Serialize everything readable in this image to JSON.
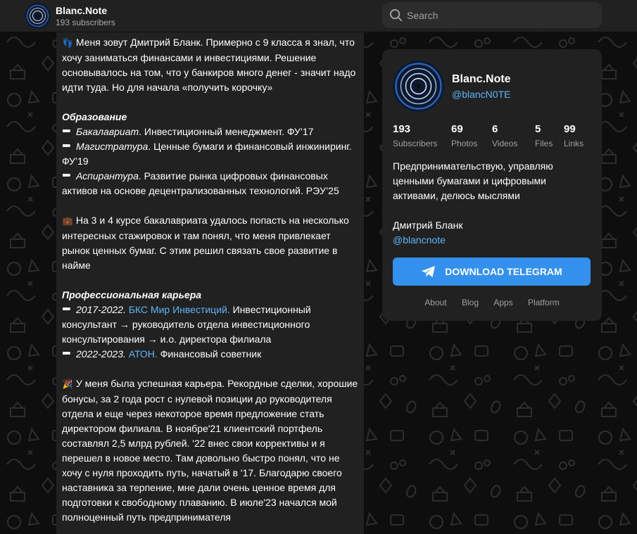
{
  "header": {
    "channel_title": "Blanc.Note",
    "subscribers_label": "193 subscribers"
  },
  "search": {
    "placeholder": "Search",
    "value": ""
  },
  "post": {
    "intro": "Меня зовут Дмитрий Бланк. Примерно с 9 класса я знал, что хочу заниматься финансами и инвестициями. Решение основывалось на том, что у банкиров много денег - значит надо идти туда. Но для начала «получить корочку»",
    "education_heading": "Образование",
    "edu1_label": "Бакалавриат",
    "edu1_text": ". Инвестиционный менеджмент. ФУ’17",
    "edu2_label": "Магистратура",
    "edu2_text": ". Ценные бумаги и финансовый инжиниринг. ФУ’19",
    "edu3_label": "Аспирантура",
    "edu3_text": ". Развитие рынка цифровых финансовых активов на основе децентрализованных технологий. РЭУ’25",
    "internship": "На 3 и 4 курсе бакалавриата удалось попасть на несколько интересных стажировок и там понял, что меня привлекает рынок ценных бумаг. С этим решил связать свое развитие в найме",
    "career_heading": "Профессиональная карьера",
    "job1_period": "2017-2022.",
    "job1_link": "БКС Мир Инвестиций.",
    "job1_text": "Инвестиционный консультант → руководитель отдела инвестиционного консультирования → и.о. директора филиала",
    "job2_period": "2022-2023.",
    "job2_link": "АТОН.",
    "job2_text": "Финансовый советник",
    "story": "У меня была успешная карьера. Рекордные сделки, хорошие бонусы, за 2 года рост с нулевой позиции до руководителя отдела и еще через некоторое время предложение стать директором филиала. В ноябре'21 клиентский портфель составлял 2,5 млрд рублей. '22 внес свои коррективы и я перешел в новое место. Там довольно быстро понял, что не хочу с нуля проходить путь, начатый в '17. Благодарю своего наставника за терпение, мне дали очень ценное время для подготовки к свободному плаванию. В июле'23 начался мой полноценный путь предпринимателя"
  },
  "card": {
    "name": "Blanc.Note",
    "handle": "@blancN0TE",
    "stats": [
      {
        "num": "193",
        "label": "Subscribers"
      },
      {
        "num": "69",
        "label": "Photos"
      },
      {
        "num": "6",
        "label": "Videos"
      },
      {
        "num": "5",
        "label": "Files"
      },
      {
        "num": "99",
        "label": "Links"
      }
    ],
    "description": "Предпринимательствую, управляю ценными бумагами и цифровыми активами, делюсь мыслями",
    "owner_name": "Дмитрий Бланк",
    "owner_handle": "@blancnote",
    "download_label": "DOWNLOAD TELEGRAM",
    "footer_links": [
      "About",
      "Blog",
      "Apps",
      "Platform"
    ]
  },
  "colors": {
    "accent": "#3390ec",
    "link": "#5eb5f7",
    "panel": "#212121",
    "background": "#0e0e0e"
  },
  "icons": [
    "channel-avatar-icon",
    "search-icon",
    "footprints-icon",
    "pointing-hand-icon",
    "briefcase-icon",
    "party-popper-icon",
    "telegram-plane-icon"
  ]
}
